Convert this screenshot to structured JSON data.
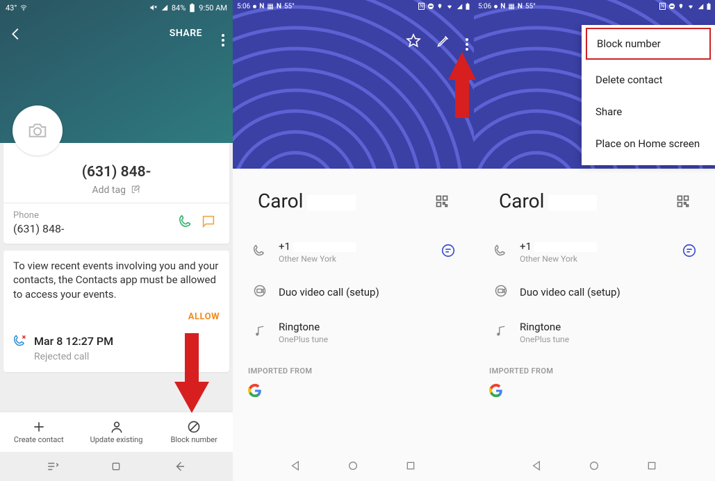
{
  "phone1": {
    "status": {
      "temp": "43°",
      "battery_pct": "84%",
      "time": "9:50 AM"
    },
    "header": {
      "share": "SHARE"
    },
    "contact": {
      "number": "(631) 848-",
      "add_tag": "Add tag",
      "phone_label": "Phone",
      "phone_value": "(631) 848-"
    },
    "events_card": {
      "msg": "To view recent events involving you and your contacts, the Contacts app must be allowed to access your events.",
      "allow": "ALLOW",
      "recent_date": "Mar 8 12:27 PM",
      "recent_sub": "Rejected call"
    },
    "bottom": {
      "create": "Create contact",
      "update": "Update existing",
      "block": "Block number"
    }
  },
  "phone2": {
    "status": {
      "time": "5:06",
      "temp": "55°"
    },
    "name": "Carol",
    "phone_prefix": "+1",
    "phone_sub": "Other New York",
    "duo": "Duo video call (setup)",
    "ringtone_label": "Ringtone",
    "ringtone_value": "OnePlus tune",
    "imported": "IMPORTED FROM"
  },
  "phone3": {
    "status": {
      "time": "5:06",
      "temp": "55°"
    },
    "name": "Carol",
    "phone_prefix": "+1",
    "phone_sub": "Other New York",
    "duo": "Duo video call (setup)",
    "ringtone_label": "Ringtone",
    "ringtone_value": "OnePlus tune",
    "imported": "IMPORTED FROM",
    "menu": {
      "block": "Block number",
      "delete": "Delete contact",
      "share": "Share",
      "place_home": "Place on Home screen"
    }
  }
}
